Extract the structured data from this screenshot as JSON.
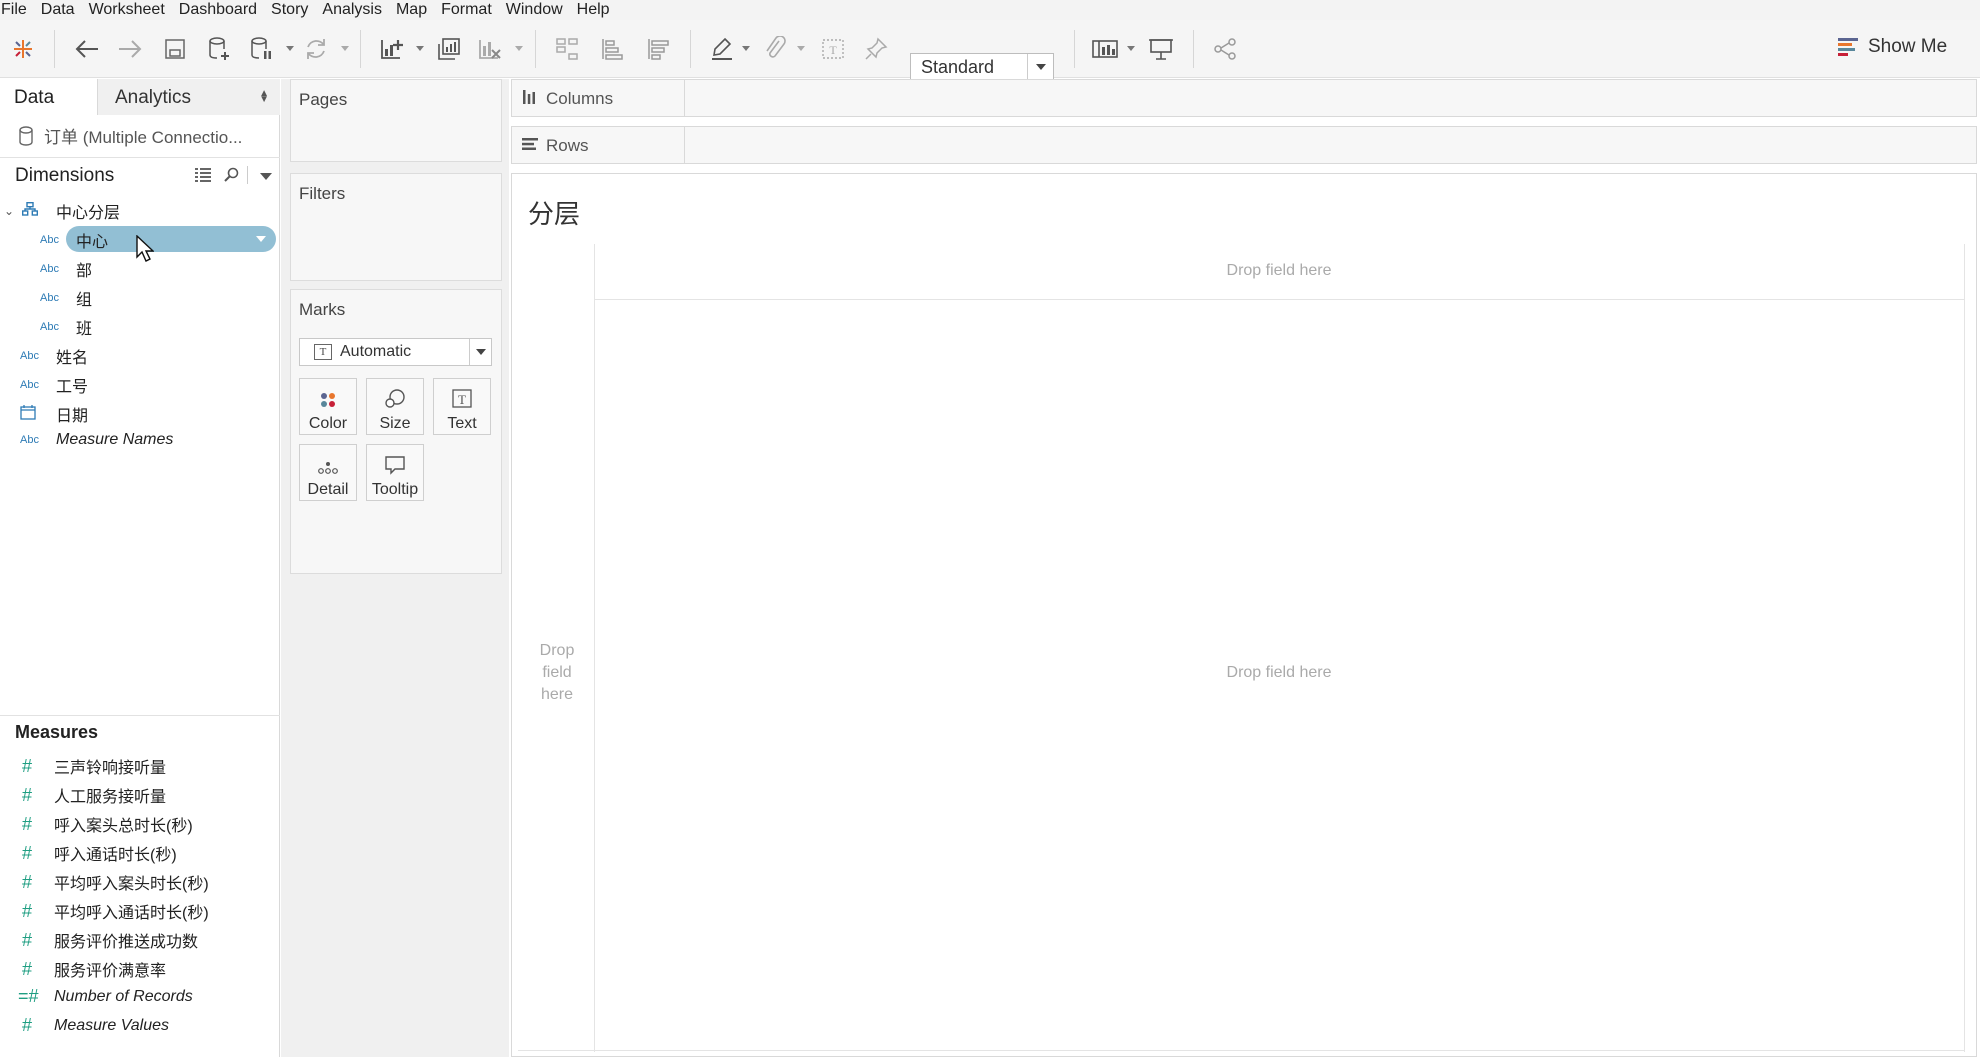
{
  "menu": [
    "File",
    "Data",
    "Worksheet",
    "Dashboard",
    "Story",
    "Analysis",
    "Map",
    "Format",
    "Window",
    "Help"
  ],
  "toolbar": {
    "fit_select": "Standard",
    "show_me": "Show Me"
  },
  "data_pane": {
    "tab_data": "Data",
    "tab_analytics": "Analytics",
    "connection": "订单 (Multiple Connectio...",
    "dimensions_title": "Dimensions",
    "hierarchy": "中心分层",
    "hier_fields": [
      {
        "type": "Abc",
        "name": "中心"
      },
      {
        "type": "Abc",
        "name": "部"
      },
      {
        "type": "Abc",
        "name": "组"
      },
      {
        "type": "Abc",
        "name": "班"
      }
    ],
    "dim_fields": [
      {
        "type": "Abc",
        "name": "姓名"
      },
      {
        "type": "Abc",
        "name": "工号"
      },
      {
        "type": "date",
        "name": "日期"
      },
      {
        "type": "Abc",
        "name": "Measure Names"
      }
    ],
    "measures_title": "Measures",
    "measures": [
      "三声铃响接听量",
      "人工服务接听量",
      "呼入案头总时长(秒)",
      "呼入通话时长(秒)",
      "平均呼入案头时长(秒)",
      "平均呼入通话时长(秒)",
      "服务评价推送成功数",
      "服务评价满意率",
      "Number of Records",
      "Measure Values"
    ]
  },
  "cards": {
    "pages": "Pages",
    "filters": "Filters",
    "marks": "Marks",
    "mark_type": "Automatic",
    "color": "Color",
    "size": "Size",
    "text": "Text",
    "detail": "Detail",
    "tooltip": "Tooltip"
  },
  "shelves": {
    "columns": "Columns",
    "rows": "Rows"
  },
  "view": {
    "title": "分层",
    "drop_top": "Drop field here",
    "drop_left": "Drop field here",
    "drop_center": "Drop field here"
  },
  "colors": {
    "pill": "#92bfd4",
    "dimension_icon": "#2e7bb5",
    "measure_icon": "#1f9e82"
  }
}
